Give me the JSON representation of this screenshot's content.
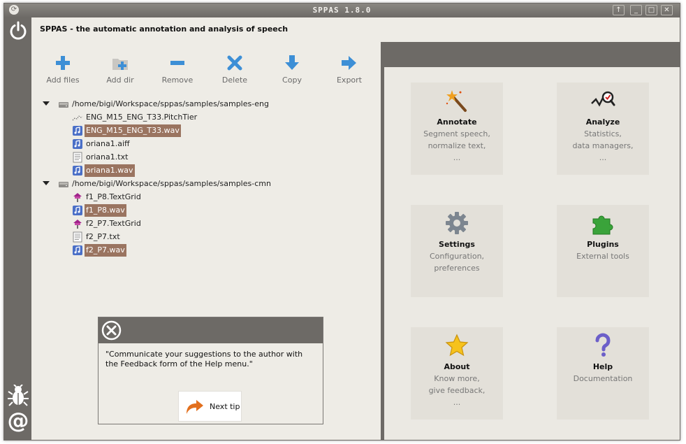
{
  "window": {
    "title": "SPPAS 1.8.0",
    "controls": [
      "↑",
      "_",
      "□",
      "✕"
    ]
  },
  "header": {
    "app_title": "SPPAS - the automatic annotation and analysis of speech"
  },
  "toolbar": {
    "add_files": "Add files",
    "add_dir": "Add dir",
    "remove": "Remove",
    "delete": "Delete",
    "copy": "Copy",
    "export": "Export"
  },
  "tree": {
    "folders": [
      {
        "path": "/home/bigi/Workspace/sppas/samples/samples-eng",
        "files": [
          {
            "name": "ENG_M15_ENG_T33.PitchTier",
            "icon": "pitchtier-icon",
            "selected": false
          },
          {
            "name": "ENG_M15_ENG_T33.wav",
            "icon": "audio-file-icon",
            "selected": true
          },
          {
            "name": "oriana1.aiff",
            "icon": "audio-file-icon",
            "selected": false
          },
          {
            "name": "oriana1.txt",
            "icon": "text-file-icon",
            "selected": false
          },
          {
            "name": "oriana1.wav",
            "icon": "audio-file-icon",
            "selected": true
          }
        ]
      },
      {
        "path": "/home/bigi/Workspace/sppas/samples/samples-cmn",
        "files": [
          {
            "name": "f1_P8.TextGrid",
            "icon": "textgrid-icon",
            "selected": false
          },
          {
            "name": "f1_P8.wav",
            "icon": "audio-file-icon",
            "selected": true
          },
          {
            "name": "f2_P7.TextGrid",
            "icon": "textgrid-icon",
            "selected": false
          },
          {
            "name": "f2_P7.txt",
            "icon": "text-file-icon",
            "selected": false
          },
          {
            "name": "f2_P7.wav",
            "icon": "audio-file-icon",
            "selected": true
          }
        ]
      }
    ]
  },
  "tip": {
    "message": "\"Communicate your suggestions to the author with the Feedback form of the Help menu.\"",
    "next_label": "Next tip"
  },
  "cards": {
    "annotate": {
      "title": "Annotate",
      "desc": "Segment speech,\nnormalize text,\n..."
    },
    "analyze": {
      "title": "Analyze",
      "desc": "Statistics,\ndata managers,\n..."
    },
    "settings": {
      "title": "Settings",
      "desc": "Configuration,\npreferences"
    },
    "plugins": {
      "title": "Plugins",
      "desc": "External tools"
    },
    "about": {
      "title": "About",
      "desc": "Know more,\ngive feedback,\n..."
    },
    "help": {
      "title": "Help",
      "desc": "Documentation"
    }
  },
  "colors": {
    "chrome": "#6d6a66",
    "selection": "#9a7460",
    "toolbar_icon": "#3d8fd6",
    "card_bg": "#e3e0d9"
  }
}
